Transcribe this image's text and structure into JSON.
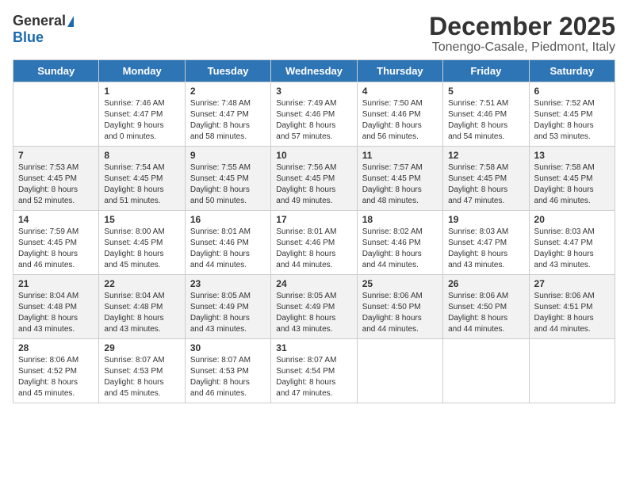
{
  "logo": {
    "general": "General",
    "blue": "Blue"
  },
  "header": {
    "month": "December 2025",
    "location": "Tonengo-Casale, Piedmont, Italy"
  },
  "weekdays": [
    "Sunday",
    "Monday",
    "Tuesday",
    "Wednesday",
    "Thursday",
    "Friday",
    "Saturday"
  ],
  "weeks": [
    [
      {
        "day": "",
        "info": ""
      },
      {
        "day": "1",
        "info": "Sunrise: 7:46 AM\nSunset: 4:47 PM\nDaylight: 9 hours\nand 0 minutes."
      },
      {
        "day": "2",
        "info": "Sunrise: 7:48 AM\nSunset: 4:47 PM\nDaylight: 8 hours\nand 58 minutes."
      },
      {
        "day": "3",
        "info": "Sunrise: 7:49 AM\nSunset: 4:46 PM\nDaylight: 8 hours\nand 57 minutes."
      },
      {
        "day": "4",
        "info": "Sunrise: 7:50 AM\nSunset: 4:46 PM\nDaylight: 8 hours\nand 56 minutes."
      },
      {
        "day": "5",
        "info": "Sunrise: 7:51 AM\nSunset: 4:46 PM\nDaylight: 8 hours\nand 54 minutes."
      },
      {
        "day": "6",
        "info": "Sunrise: 7:52 AM\nSunset: 4:45 PM\nDaylight: 8 hours\nand 53 minutes."
      }
    ],
    [
      {
        "day": "7",
        "info": "Sunrise: 7:53 AM\nSunset: 4:45 PM\nDaylight: 8 hours\nand 52 minutes."
      },
      {
        "day": "8",
        "info": "Sunrise: 7:54 AM\nSunset: 4:45 PM\nDaylight: 8 hours\nand 51 minutes."
      },
      {
        "day": "9",
        "info": "Sunrise: 7:55 AM\nSunset: 4:45 PM\nDaylight: 8 hours\nand 50 minutes."
      },
      {
        "day": "10",
        "info": "Sunrise: 7:56 AM\nSunset: 4:45 PM\nDaylight: 8 hours\nand 49 minutes."
      },
      {
        "day": "11",
        "info": "Sunrise: 7:57 AM\nSunset: 4:45 PM\nDaylight: 8 hours\nand 48 minutes."
      },
      {
        "day": "12",
        "info": "Sunrise: 7:58 AM\nSunset: 4:45 PM\nDaylight: 8 hours\nand 47 minutes."
      },
      {
        "day": "13",
        "info": "Sunrise: 7:58 AM\nSunset: 4:45 PM\nDaylight: 8 hours\nand 46 minutes."
      }
    ],
    [
      {
        "day": "14",
        "info": "Sunrise: 7:59 AM\nSunset: 4:45 PM\nDaylight: 8 hours\nand 46 minutes."
      },
      {
        "day": "15",
        "info": "Sunrise: 8:00 AM\nSunset: 4:45 PM\nDaylight: 8 hours\nand 45 minutes."
      },
      {
        "day": "16",
        "info": "Sunrise: 8:01 AM\nSunset: 4:46 PM\nDaylight: 8 hours\nand 44 minutes."
      },
      {
        "day": "17",
        "info": "Sunrise: 8:01 AM\nSunset: 4:46 PM\nDaylight: 8 hours\nand 44 minutes."
      },
      {
        "day": "18",
        "info": "Sunrise: 8:02 AM\nSunset: 4:46 PM\nDaylight: 8 hours\nand 44 minutes."
      },
      {
        "day": "19",
        "info": "Sunrise: 8:03 AM\nSunset: 4:47 PM\nDaylight: 8 hours\nand 43 minutes."
      },
      {
        "day": "20",
        "info": "Sunrise: 8:03 AM\nSunset: 4:47 PM\nDaylight: 8 hours\nand 43 minutes."
      }
    ],
    [
      {
        "day": "21",
        "info": "Sunrise: 8:04 AM\nSunset: 4:48 PM\nDaylight: 8 hours\nand 43 minutes."
      },
      {
        "day": "22",
        "info": "Sunrise: 8:04 AM\nSunset: 4:48 PM\nDaylight: 8 hours\nand 43 minutes."
      },
      {
        "day": "23",
        "info": "Sunrise: 8:05 AM\nSunset: 4:49 PM\nDaylight: 8 hours\nand 43 minutes."
      },
      {
        "day": "24",
        "info": "Sunrise: 8:05 AM\nSunset: 4:49 PM\nDaylight: 8 hours\nand 43 minutes."
      },
      {
        "day": "25",
        "info": "Sunrise: 8:06 AM\nSunset: 4:50 PM\nDaylight: 8 hours\nand 44 minutes."
      },
      {
        "day": "26",
        "info": "Sunrise: 8:06 AM\nSunset: 4:50 PM\nDaylight: 8 hours\nand 44 minutes."
      },
      {
        "day": "27",
        "info": "Sunrise: 8:06 AM\nSunset: 4:51 PM\nDaylight: 8 hours\nand 44 minutes."
      }
    ],
    [
      {
        "day": "28",
        "info": "Sunrise: 8:06 AM\nSunset: 4:52 PM\nDaylight: 8 hours\nand 45 minutes."
      },
      {
        "day": "29",
        "info": "Sunrise: 8:07 AM\nSunset: 4:53 PM\nDaylight: 8 hours\nand 45 minutes."
      },
      {
        "day": "30",
        "info": "Sunrise: 8:07 AM\nSunset: 4:53 PM\nDaylight: 8 hours\nand 46 minutes."
      },
      {
        "day": "31",
        "info": "Sunrise: 8:07 AM\nSunset: 4:54 PM\nDaylight: 8 hours\nand 47 minutes."
      },
      {
        "day": "",
        "info": ""
      },
      {
        "day": "",
        "info": ""
      },
      {
        "day": "",
        "info": ""
      }
    ]
  ]
}
